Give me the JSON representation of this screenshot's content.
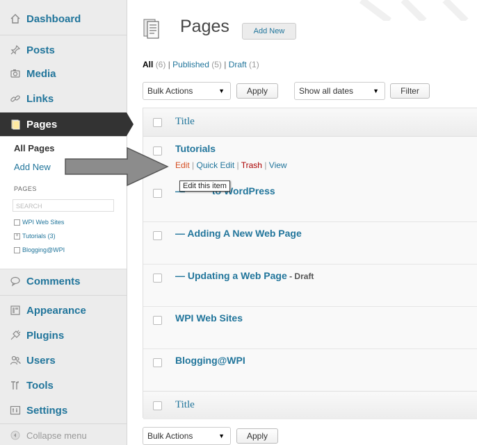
{
  "sidebar": {
    "items": [
      {
        "label": "Dashboard",
        "icon": "home-icon"
      },
      {
        "label": "Posts",
        "icon": "pushpin-icon"
      },
      {
        "label": "Media",
        "icon": "camera-icon"
      },
      {
        "label": "Links",
        "icon": "chain-link-icon"
      },
      {
        "label": "Pages",
        "icon": "pages-icon"
      },
      {
        "label": "Comments",
        "icon": "speech-bubble-icon"
      },
      {
        "label": "Appearance",
        "icon": "appearance-icon"
      },
      {
        "label": "Plugins",
        "icon": "plug-icon"
      },
      {
        "label": "Users",
        "icon": "users-icon"
      },
      {
        "label": "Tools",
        "icon": "tools-icon"
      },
      {
        "label": "Settings",
        "icon": "settings-icon"
      }
    ],
    "submenu": {
      "all_pages": "All Pages",
      "add_new": "Add New"
    },
    "widget": {
      "title": "PAGES",
      "search_placeholder": "SEARCH",
      "tree": [
        {
          "label": "WPI Web Sites",
          "marker": ""
        },
        {
          "label": "Tutorials (3)",
          "marker": "+"
        },
        {
          "label": "Blogging@WPI",
          "marker": ""
        }
      ]
    },
    "collapse_label": "Collapse menu"
  },
  "header": {
    "title": "Pages",
    "add_new": "Add New"
  },
  "filters": {
    "all": "All",
    "all_count": "(6)",
    "sep1": " | ",
    "published": "Published",
    "published_count": "(5)",
    "sep2": " | ",
    "draft": "Draft",
    "draft_count": "(1)"
  },
  "toolbar": {
    "bulk_actions": "Bulk Actions",
    "apply": "Apply",
    "show_all_dates": "Show all dates",
    "filter": "Filter"
  },
  "table": {
    "column_title": "Title",
    "rows": [
      {
        "title": "Tutorials",
        "suffix": ""
      },
      {
        "title": "— Intro to WordPress",
        "visible_title": "to WordPress",
        "suffix": ""
      },
      {
        "title": "— Adding A New Web Page",
        "suffix": ""
      },
      {
        "title": "— Updating a Web Page",
        "suffix": " - Draft"
      },
      {
        "title": "WPI Web Sites",
        "suffix": ""
      },
      {
        "title": "Blogging@WPI",
        "suffix": ""
      }
    ],
    "row_actions": {
      "edit": "Edit",
      "quick_edit": "Quick Edit",
      "trash": "Trash",
      "view": "View",
      "sep": " | "
    },
    "tooltip": "Edit this item"
  },
  "footer_toolbar": {
    "bulk_actions": "Bulk Actions",
    "apply": "Apply"
  },
  "colors": {
    "link": "#21759b",
    "current_menu": "#333333",
    "edit": "#d54e21",
    "trash": "#aa0000",
    "arrow": "#8c8c8c"
  }
}
